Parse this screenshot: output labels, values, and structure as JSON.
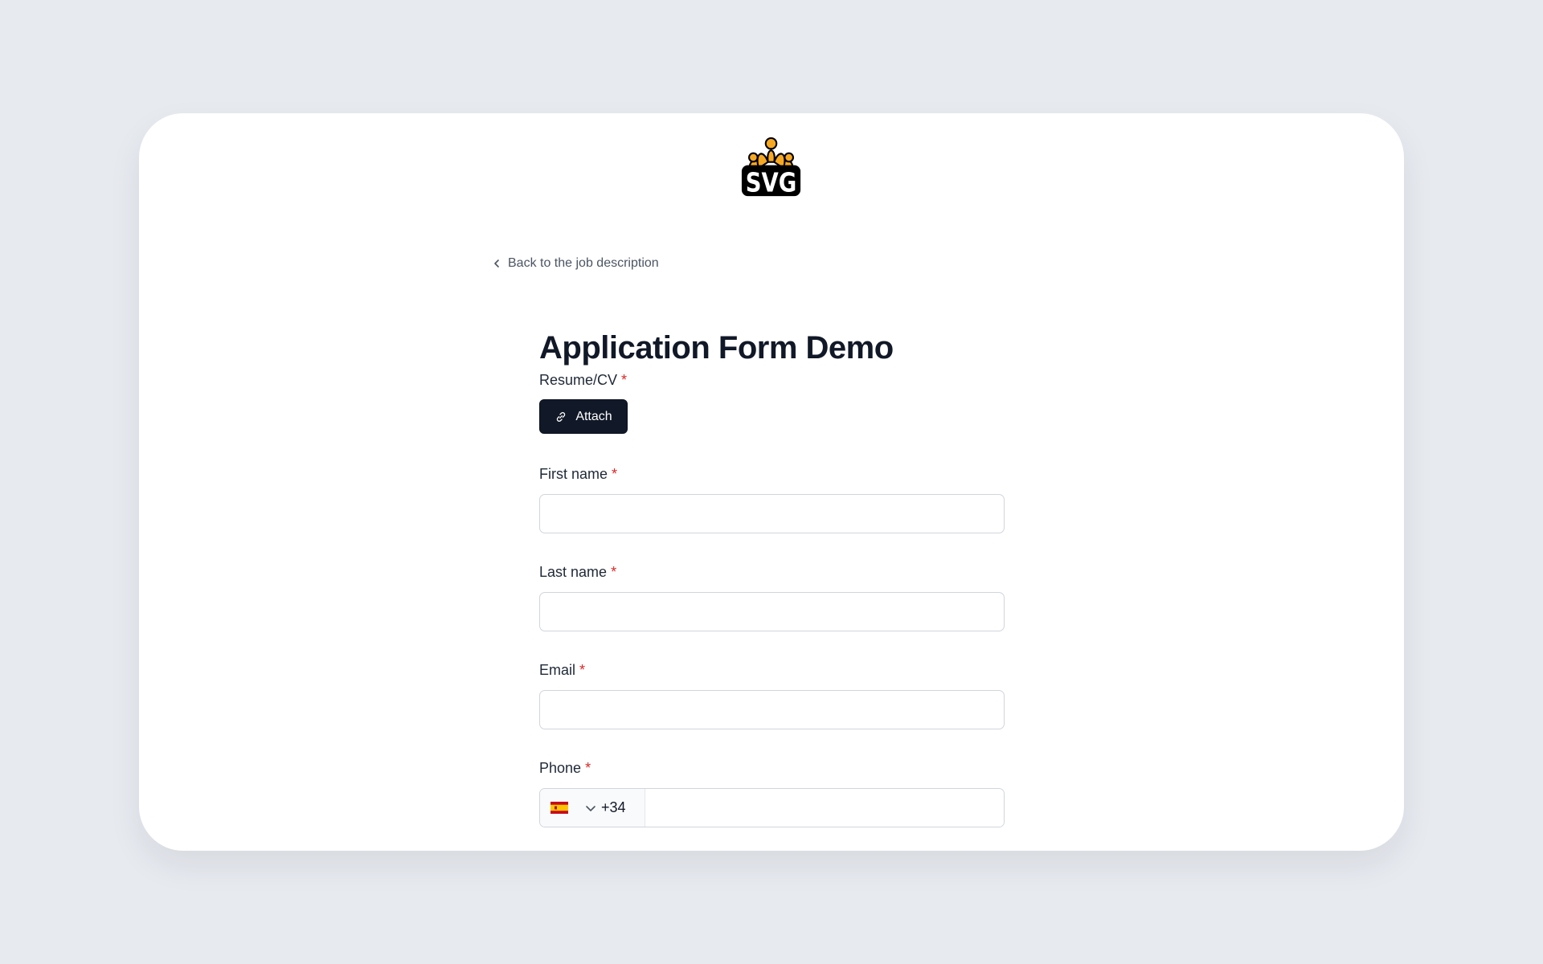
{
  "logo": {
    "text": "SVG",
    "icon": "svg-logo-icon"
  },
  "nav": {
    "back_label": "Back to the job description"
  },
  "form": {
    "title": "Application Form Demo",
    "required_marker": "*",
    "resume": {
      "label": "Resume/CV",
      "attach_label": "Attach"
    },
    "first_name": {
      "label": "First name",
      "value": "",
      "placeholder": ""
    },
    "last_name": {
      "label": "Last name",
      "value": "",
      "placeholder": ""
    },
    "email": {
      "label": "Email",
      "value": "",
      "placeholder": ""
    },
    "phone": {
      "label": "Phone",
      "country_code": "+34",
      "country_flag": "spain-flag-icon",
      "value": ""
    }
  },
  "colors": {
    "background": "#e7eaef",
    "card": "#ffffff",
    "primary_button": "#111827",
    "required": "#dc2626",
    "logo_orange": "#f7a823"
  }
}
